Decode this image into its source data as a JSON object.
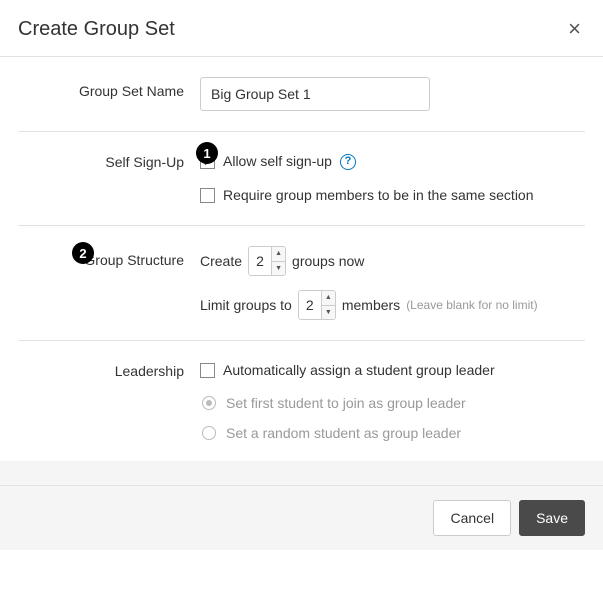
{
  "header": {
    "title": "Create Group Set",
    "close_label": "×"
  },
  "badges": {
    "one": "1",
    "two": "2"
  },
  "name": {
    "label": "Group Set Name",
    "value": "Big Group Set 1"
  },
  "self_signup": {
    "label": "Self Sign-Up",
    "allow_label": "Allow self sign-up",
    "help_char": "?",
    "same_section_label": "Require group members to be in the same section"
  },
  "structure": {
    "label": "Group Structure",
    "create_prefix": "Create",
    "create_value": "2",
    "create_suffix": "groups now",
    "limit_prefix": "Limit groups to",
    "limit_value": "2",
    "limit_suffix": "members",
    "limit_hint": "(Leave blank for no limit)"
  },
  "leadership": {
    "label": "Leadership",
    "auto_label": "Automatically assign a student group leader",
    "first_label": "Set first student to join as group leader",
    "random_label": "Set a random student as group leader"
  },
  "footer": {
    "cancel": "Cancel",
    "save": "Save"
  }
}
